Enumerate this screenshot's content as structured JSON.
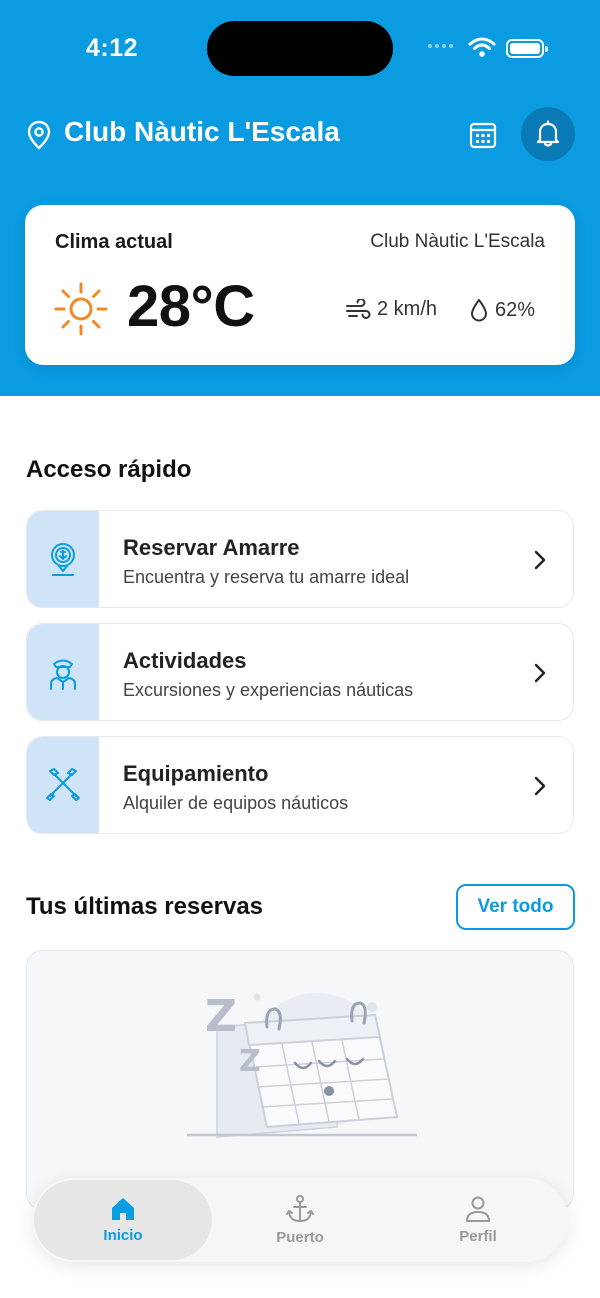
{
  "status_bar": {
    "time": "4:12"
  },
  "header": {
    "title": "Club Nàutic L'Escala"
  },
  "weather": {
    "title": "Clima actual",
    "location": "Club Nàutic L'Escala",
    "temperature": "28°C",
    "wind": "2 km/h",
    "humidity": "62%"
  },
  "quick_access": {
    "title": "Acceso rápido",
    "items": [
      {
        "title": "Reservar Amarre",
        "subtitle": "Encuentra y reserva tu amarre ideal",
        "icon": "anchor-pin-icon"
      },
      {
        "title": "Actividades",
        "subtitle": "Excursiones y experiencias náuticas",
        "icon": "captain-icon"
      },
      {
        "title": "Equipamiento",
        "subtitle": "Alquiler de equipos náuticos",
        "icon": "crossed-paddles-icon"
      }
    ]
  },
  "reservations": {
    "title": "Tus últimas reservas",
    "view_all": "Ver todo"
  },
  "tabbar": {
    "items": [
      {
        "label": "Inicio",
        "icon": "home-icon",
        "active": true
      },
      {
        "label": "Puerto",
        "icon": "anchor-icon",
        "active": false
      },
      {
        "label": "Perfil",
        "icon": "user-icon",
        "active": false
      }
    ]
  },
  "colors": {
    "primary": "#0a9be0",
    "icon_box": "#cfe5f7",
    "sun": "#f08a24"
  }
}
